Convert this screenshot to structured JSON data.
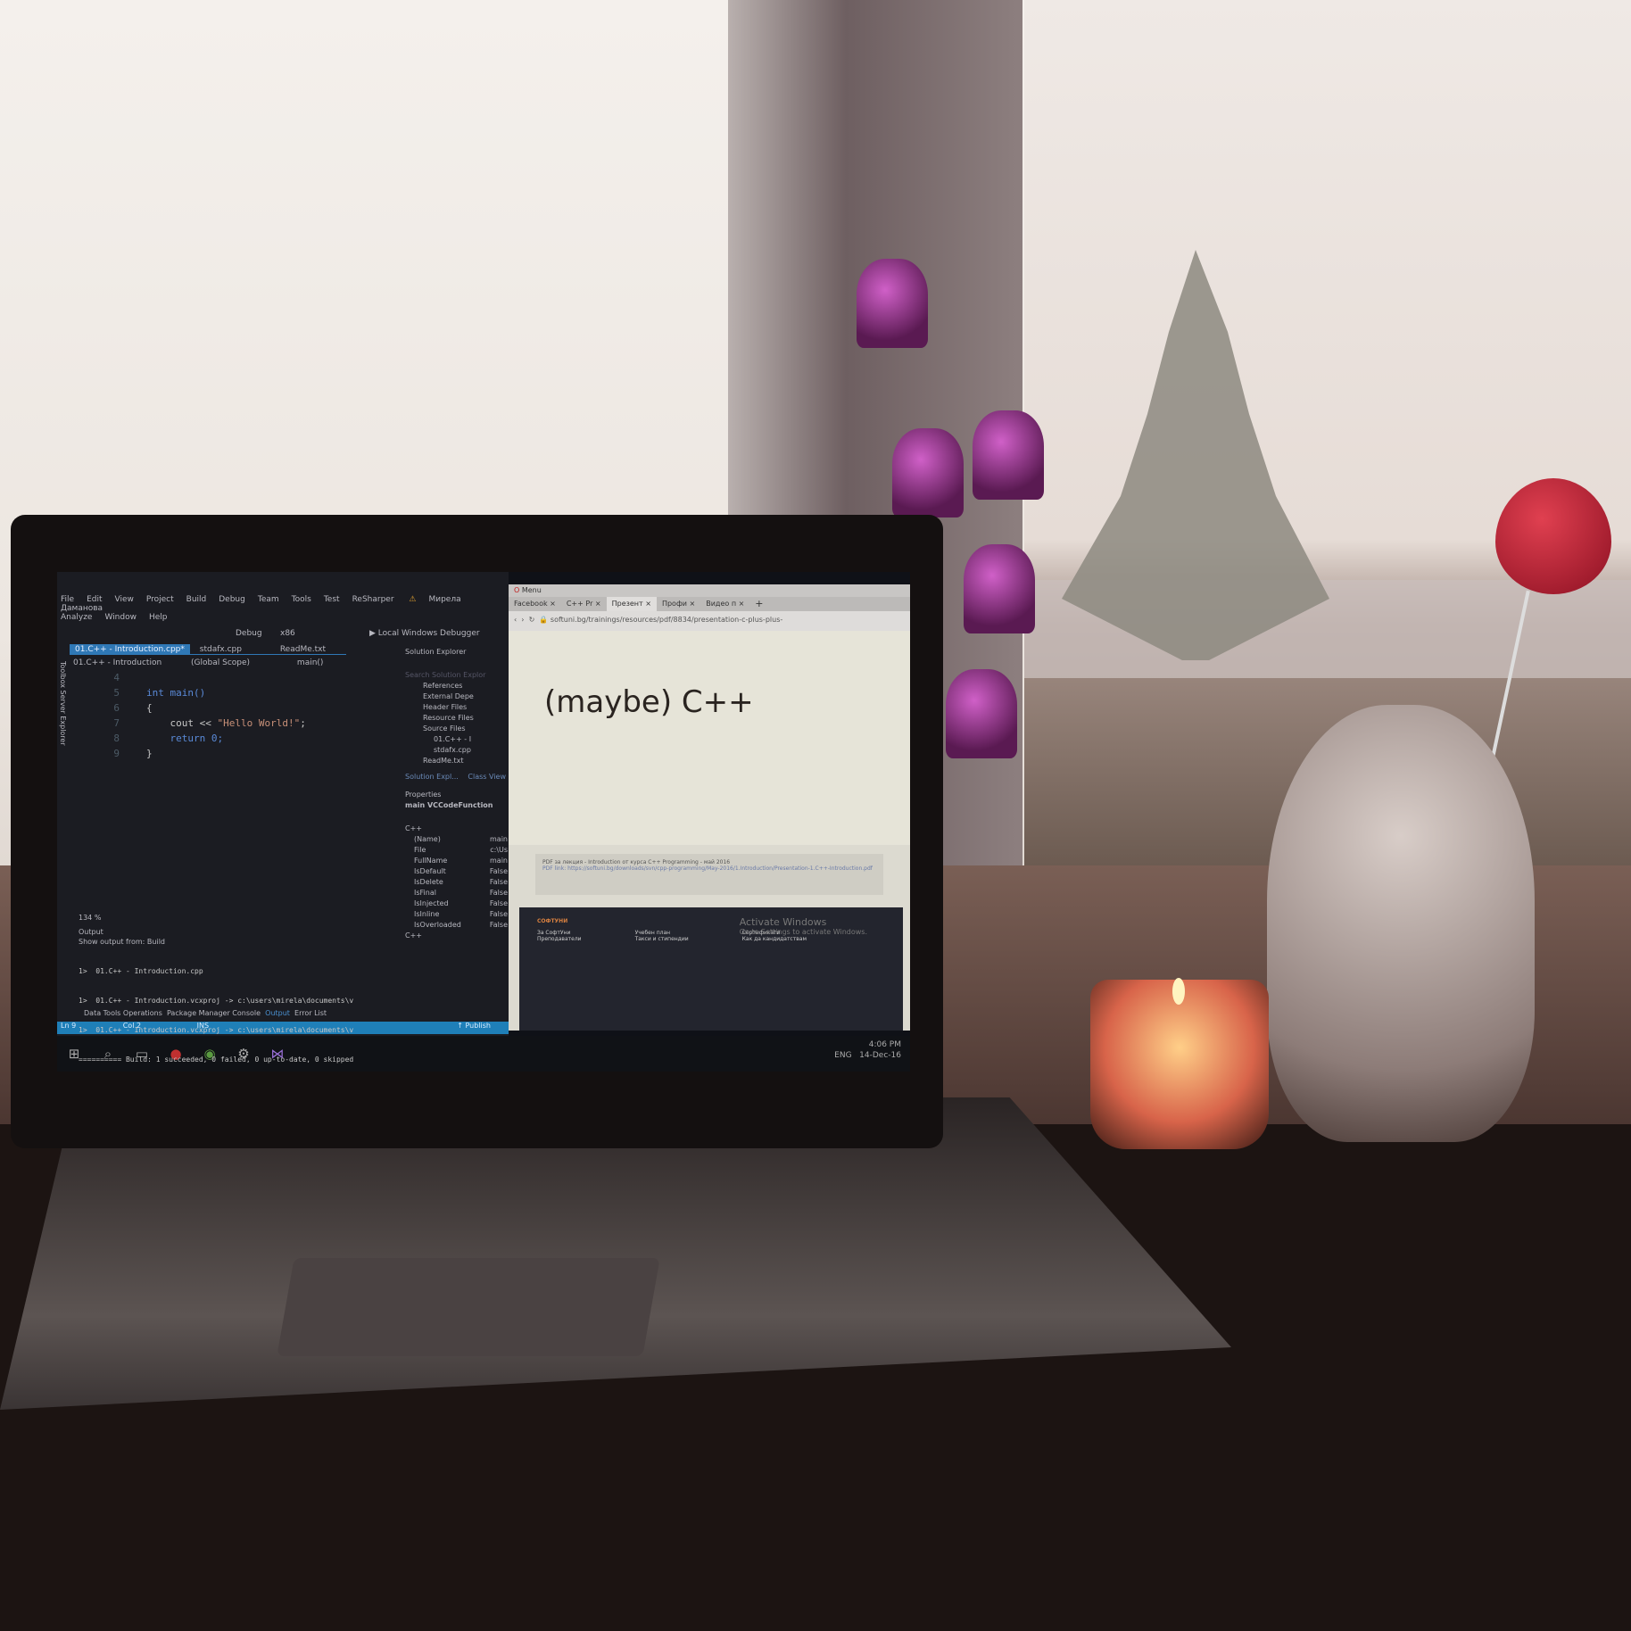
{
  "vs": {
    "menu": [
      "File",
      "Edit",
      "View",
      "Project",
      "Build",
      "Debug",
      "Team",
      "Tools",
      "Test",
      "ReSharper"
    ],
    "menu2": [
      "Analyze",
      "Window",
      "Help"
    ],
    "user": "Мирела Даманова",
    "config": "Debug",
    "platform": "x86",
    "run": "Local Windows Debugger",
    "tabs": [
      "01.C++ - Introduction.cpp*",
      "stdafx.cpp",
      "ReadMe.txt"
    ],
    "nav": [
      "01.C++ - Introduction",
      "(Global Scope)",
      "main()"
    ],
    "side_labels": [
      "Toolbox",
      "Server Explorer"
    ],
    "code": [
      {
        "n": "4",
        "t": ""
      },
      {
        "n": "5",
        "t": "int main()"
      },
      {
        "n": "6",
        "t": "{"
      },
      {
        "n": "7",
        "a": "cout << ",
        "s": "\"Hello World!\"",
        "b": ";"
      },
      {
        "n": "8",
        "t": "return 0;"
      },
      {
        "n": "9",
        "t": "}"
      }
    ],
    "zoom": "134 %",
    "solution_explorer": {
      "title": "Solution Explorer",
      "search": "Search Solution Explor",
      "items": [
        "References",
        "External Depe",
        "Header Files",
        "Resource Files",
        "Source Files",
        "01.C++ - I",
        "stdafx.cpp",
        "ReadMe.txt"
      ],
      "tabs": [
        "Solution Expl...",
        "Class View"
      ]
    },
    "properties": {
      "title": "Properties",
      "object": "main VCCodeFunction",
      "group": "C++",
      "rows": [
        [
          "(Name)",
          "main"
        ],
        [
          "File",
          "c:\\Us"
        ],
        [
          "FullName",
          "main"
        ],
        [
          "IsDefault",
          "False"
        ],
        [
          "IsDelete",
          "False"
        ],
        [
          "IsFinal",
          "False"
        ],
        [
          "IsInjected",
          "False"
        ],
        [
          "IsInline",
          "False"
        ],
        [
          "IsOverloaded",
          "False"
        ]
      ],
      "footer": "C++"
    },
    "output": {
      "title": "Output",
      "from_label": "Show output from:",
      "from": "Build",
      "lines": [
        "1>  01.C++ - Introduction.cpp",
        "1>  01.C++ - Introduction.vcxproj -> c:\\users\\mirela\\documents\\v",
        "1>  01.C++ - Introduction.vcxproj -> c:\\users\\mirela\\documents\\v",
        "========== Build: 1 succeeded, 0 failed, 0 up-to-date, 0 skipped"
      ]
    },
    "bottom_tabs": [
      "Data Tools Operations",
      "Package Manager Console",
      "Output",
      "Error List"
    ],
    "status": {
      "ln": "Ln 9",
      "col": "Col 2",
      "ins": "INS",
      "publish": "Publish"
    }
  },
  "browser": {
    "menu": "Menu",
    "tabs": [
      "Facebook",
      "C++ Pr",
      "Презент",
      "Профи",
      "Видео п"
    ],
    "url": "softuni.bg/trainings/resources/pdf/8834/presentation-c-plus-plus-",
    "slide_title": "(maybe) C++",
    "pdf_caption": "PDF за лекция - Introduction от курса C++ Programming - май 2016",
    "pdf_link": "PDF link: https://softuni.bg/downloads/svn/cpp-programming/May-2016/1.Introduction/Presentation-1.C++-Introduction.pdf",
    "footer_brand": "СОФТУНИ",
    "footer_col1": [
      "За СофтУни",
      "Преподаватели"
    ],
    "footer_col2": [
      "Учебен план",
      "Такси и стипендии"
    ],
    "footer_col3": [
      "Сертификати",
      "Как да кандидатствам"
    ],
    "activate_title": "Activate Windows",
    "activate_sub": "Go to Settings to activate Windows."
  },
  "taskbar": {
    "lang": "ENG",
    "time": "4:06 PM",
    "date": "14-Dec-16"
  },
  "colors": {
    "vs_accent": "#2f78b6",
    "candle": "#ffcf88",
    "heart": "#c8202e",
    "bells": "#b040a8"
  }
}
